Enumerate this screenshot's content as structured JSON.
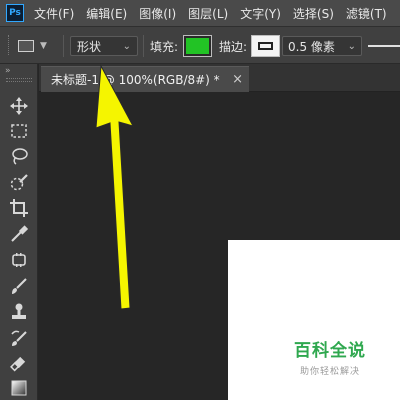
{
  "menubar": {
    "app_icon": "Ps",
    "items": [
      "文件(F)",
      "编辑(E)",
      "图像(I)",
      "图层(L)",
      "文字(Y)",
      "选择(S)",
      "滤镜(T)"
    ]
  },
  "options": {
    "mode_value": "形状",
    "fill_label": "填充:",
    "fill_color": "#22c325",
    "stroke_label": "描边:",
    "stroke_width_value": "0.5 像素"
  },
  "toolbar": {
    "collapse_glyph": "»",
    "tools": [
      "move-icon",
      "marquee-icon",
      "lasso-icon",
      "quick-select-icon",
      "crop-icon",
      "eyedropper-icon",
      "healing-brush-icon",
      "brush-icon",
      "clone-stamp-icon",
      "history-brush-icon",
      "eraser-icon",
      "gradient-icon"
    ]
  },
  "document": {
    "tab_title": "未标题-1 @ 100%(RGB/8#) *",
    "close_glyph": "×"
  },
  "annotation": {
    "arrow_color": "#f5f500"
  },
  "watermark": {
    "title": "百科全说",
    "subtitle": "助你轻松解决"
  }
}
